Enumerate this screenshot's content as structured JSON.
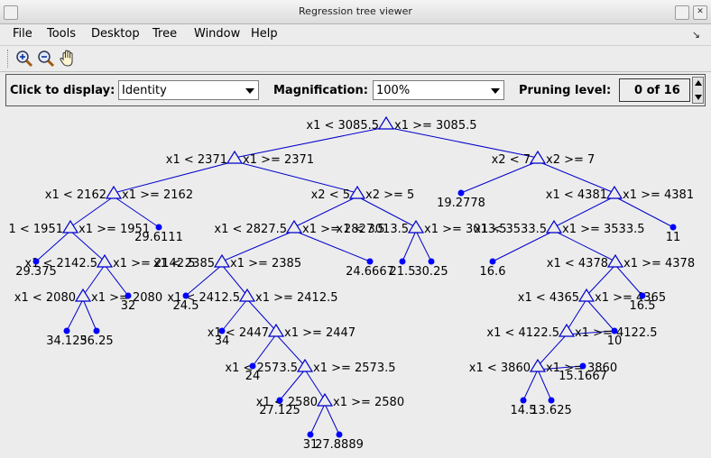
{
  "window": {
    "title": "Regression tree viewer"
  },
  "menu": [
    {
      "label": "File"
    },
    {
      "label": "Tools"
    },
    {
      "label": "Desktop"
    },
    {
      "label": "Tree"
    },
    {
      "label": "Window"
    },
    {
      "label": "Help"
    }
  ],
  "toolbar": {
    "buttons": [
      "zoom-in-icon",
      "zoom-out-icon",
      "pan-hand-icon"
    ]
  },
  "controls": {
    "display_label": "Click to display:",
    "display_value": "Identity",
    "magnification_label": "Magnification:",
    "magnification_value": "100%",
    "pruning_label": "Pruning level:",
    "pruning_value": "0 of 16"
  },
  "tree": {
    "colors": {
      "edge": "#0000cc",
      "node": "#0000ff"
    },
    "branch_nodes": [
      {
        "id": "n1",
        "left": "x1 < 3085.5",
        "right": "x1 >= 3085.5"
      },
      {
        "id": "n2",
        "left": "x1 < 2371",
        "right": "x1 >= 2371"
      },
      {
        "id": "n3",
        "left": "x2 < 7",
        "right": "x2 >= 7"
      },
      {
        "id": "n4",
        "left": "x1 < 2162",
        "right": "x1 >= 2162"
      },
      {
        "id": "n5",
        "left": "x2 < 5",
        "right": "x2 >= 5"
      },
      {
        "id": "n6",
        "left": "x1 < 4381",
        "right": "x1 >= 4381"
      },
      {
        "id": "n7",
        "left": "1 < 1951",
        "right": "x1 >= 1951"
      },
      {
        "id": "n8",
        "left": "x1 < 2827.5",
        "right": "x1 >= 2827.5"
      },
      {
        "id": "n9",
        "left": "x1 < 3013.5",
        "right": "x1 >= 3013.5"
      },
      {
        "id": "n10",
        "left": "x1 < 3533.5",
        "right": "x1 >= 3533.5"
      },
      {
        "id": "n11",
        "left": "x1 < 2142.5",
        "right": "x1 >= 2142.5"
      },
      {
        "id": "n12",
        "left": "x1 < 2385",
        "right": "x1 >= 2385"
      },
      {
        "id": "n13",
        "left": "x1 < 4378",
        "right": "x1 >= 4378"
      },
      {
        "id": "n14",
        "left": "x1 < 2080",
        "right": "x1 >= 2080"
      },
      {
        "id": "n15",
        "left": "x1 < 2412.5",
        "right": "x1 >= 2412.5"
      },
      {
        "id": "n16",
        "left": "x1 < 4365",
        "right": "x1 >= 4365"
      },
      {
        "id": "n17",
        "left": "x1 < 2447",
        "right": "x1 >= 2447"
      },
      {
        "id": "n18",
        "left": "x1 < 4122.5",
        "right": "x1 >= 4122.5"
      },
      {
        "id": "n19",
        "left": "x1 < 2573.5",
        "right": "x1 >= 2573.5"
      },
      {
        "id": "n20",
        "left": "x1 < 3860",
        "right": "x1 >= 3860"
      },
      {
        "id": "n21",
        "left": "x1 < 2580",
        "right": "x1 >= 2580"
      }
    ],
    "leaves": [
      {
        "id": "l1",
        "value": "19.2778"
      },
      {
        "id": "l2",
        "value": "11"
      },
      {
        "id": "l3",
        "value": "29.6111"
      },
      {
        "id": "l4",
        "value": "24.6667"
      },
      {
        "id": "l5",
        "value": "21.5"
      },
      {
        "id": "l6",
        "value": "30.25"
      },
      {
        "id": "l7",
        "value": "16.6"
      },
      {
        "id": "l8",
        "value": "29.375"
      },
      {
        "id": "l9",
        "value": "16.5"
      },
      {
        "id": "l10",
        "value": "32"
      },
      {
        "id": "l11",
        "value": "24.5"
      },
      {
        "id": "l12",
        "value": "34.125"
      },
      {
        "id": "l13",
        "value": "36.25"
      },
      {
        "id": "l14",
        "value": "34"
      },
      {
        "id": "l15",
        "value": "10"
      },
      {
        "id": "l16",
        "value": "24"
      },
      {
        "id": "l17",
        "value": "15.1667"
      },
      {
        "id": "l18",
        "value": "27.125"
      },
      {
        "id": "l19",
        "value": "14.5"
      },
      {
        "id": "l20",
        "value": "13.625"
      },
      {
        "id": "l21",
        "value": "31"
      },
      {
        "id": "l22",
        "value": "27.8889"
      }
    ]
  }
}
